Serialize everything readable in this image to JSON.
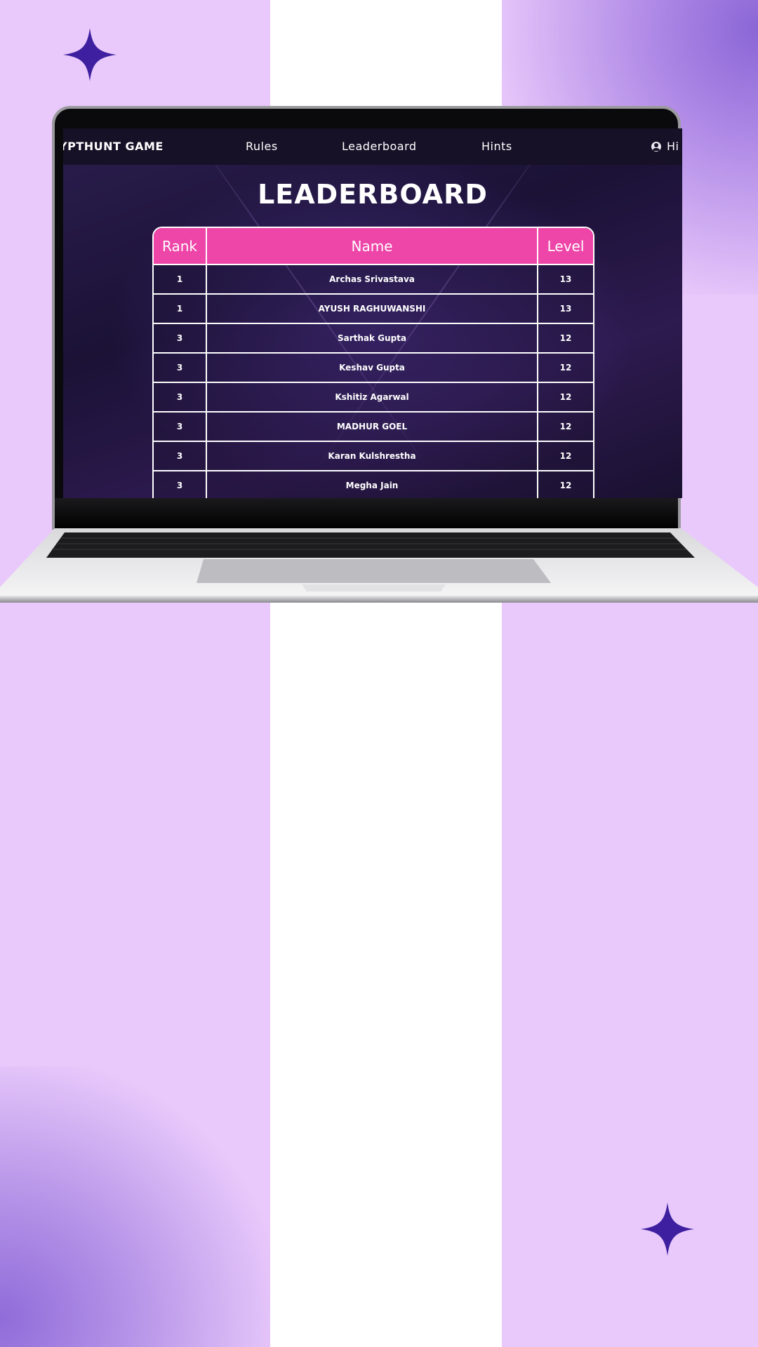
{
  "colors": {
    "background": "#e9c9fb",
    "stripe": "#ffffff",
    "sparkle": "#3d1fa0",
    "navbar": "#161127",
    "table_header": "#ee45a8",
    "table_border": "#ffffff"
  },
  "decor": {
    "sparkle_icon": "four-point-star-icon"
  },
  "navbar": {
    "brand": "YPTHUNT GAME",
    "items": [
      {
        "label": "Rules"
      },
      {
        "label": "Leaderboard"
      },
      {
        "label": "Hints"
      }
    ],
    "user": {
      "icon": "user-circle-icon",
      "label": "Hi"
    }
  },
  "page": {
    "title": "LEADERBOARD"
  },
  "table": {
    "columns": [
      "Rank",
      "Name",
      "Level"
    ],
    "rows": [
      {
        "rank": "1",
        "name": "Archas Srivastava",
        "level": "13"
      },
      {
        "rank": "1",
        "name": "AYUSH RAGHUWANSHI",
        "level": "13"
      },
      {
        "rank": "3",
        "name": "Sarthak Gupta",
        "level": "12"
      },
      {
        "rank": "3",
        "name": "Keshav Gupta",
        "level": "12"
      },
      {
        "rank": "3",
        "name": "Kshitiz Agarwal",
        "level": "12"
      },
      {
        "rank": "3",
        "name": "MADHUR GOEL",
        "level": "12"
      },
      {
        "rank": "3",
        "name": "Karan Kulshrestha",
        "level": "12"
      },
      {
        "rank": "3",
        "name": "Megha Jain",
        "level": "12"
      }
    ]
  }
}
